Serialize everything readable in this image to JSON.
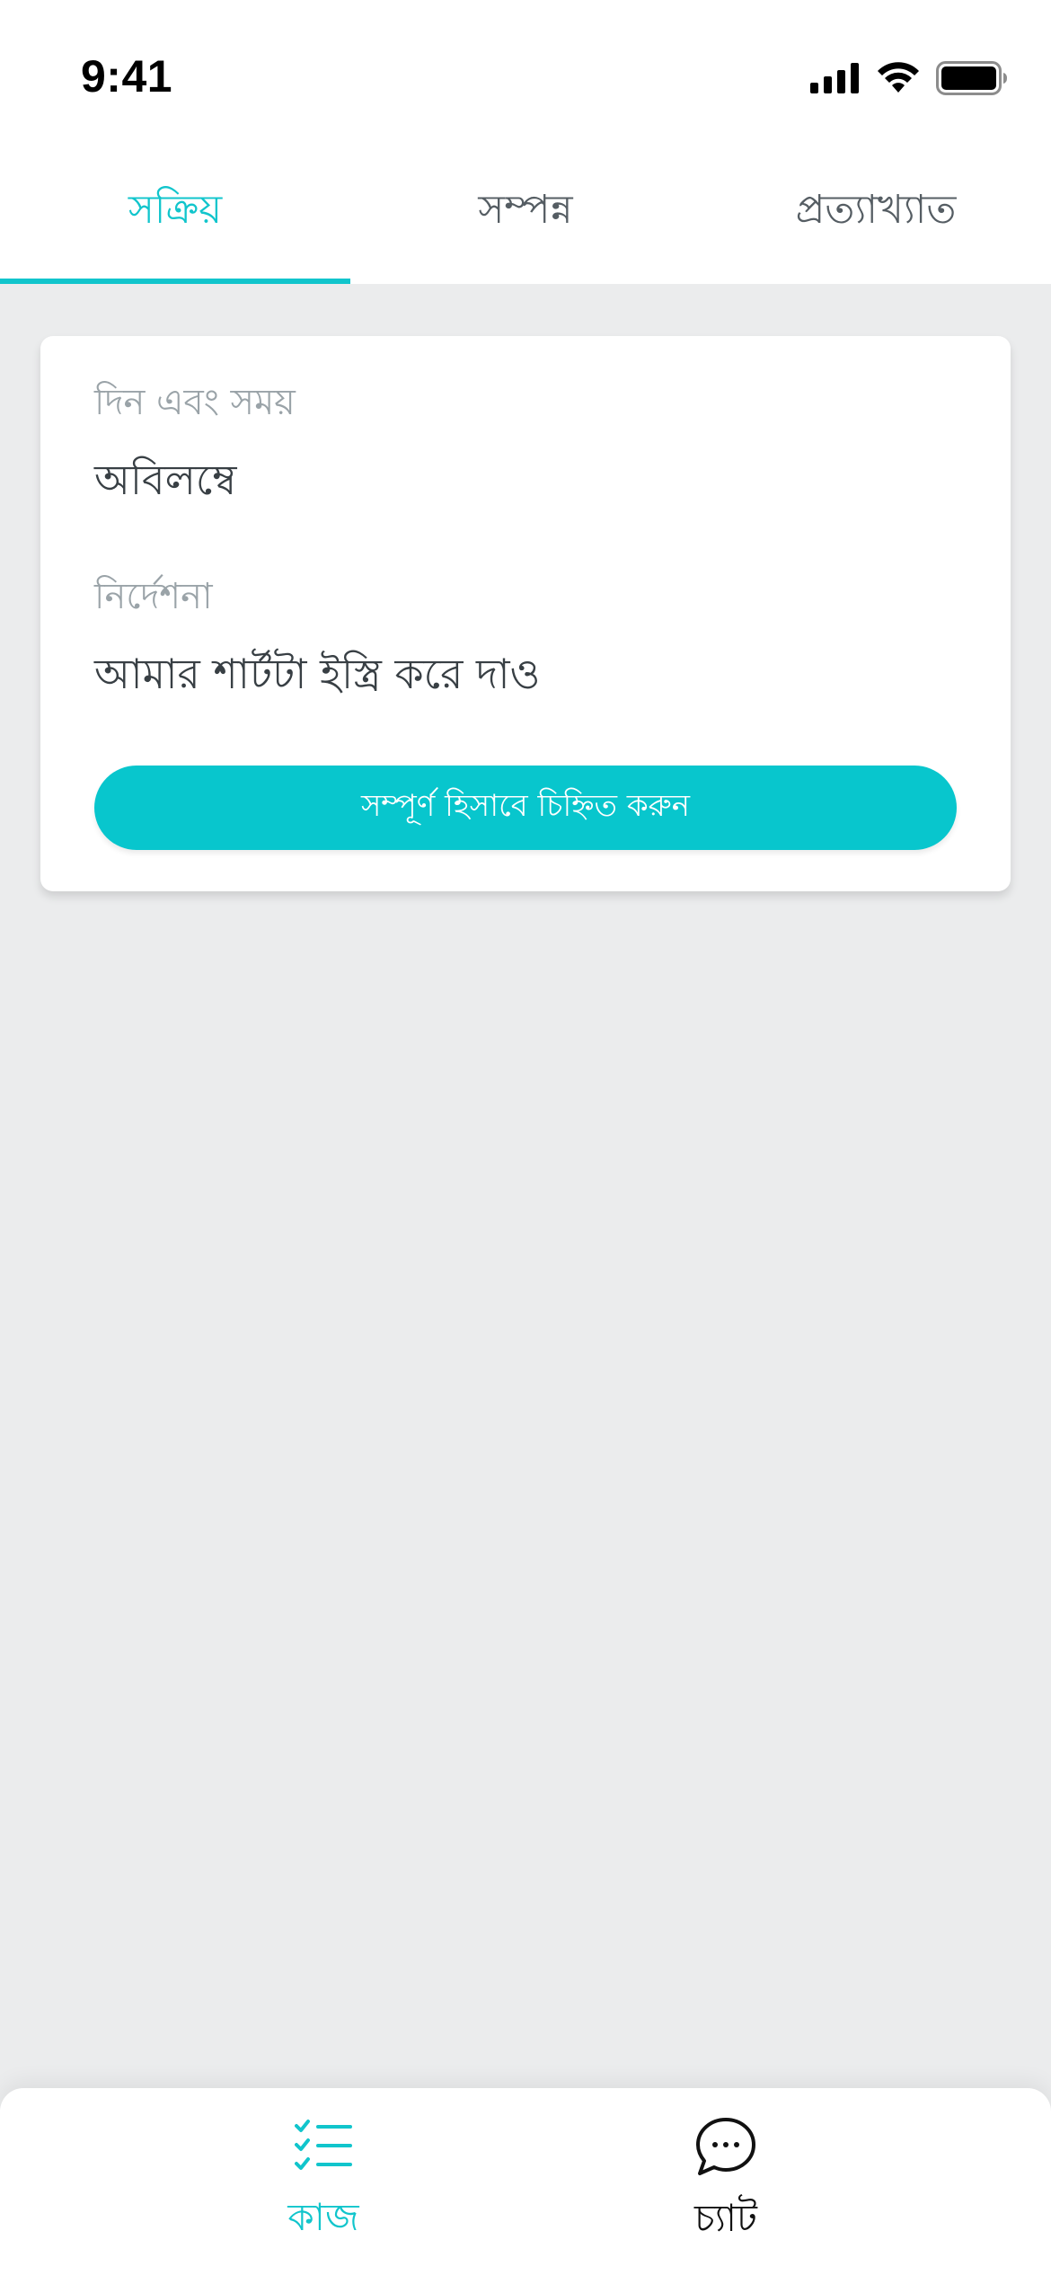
{
  "status_bar": {
    "time": "9:41"
  },
  "tabs": [
    {
      "label": "সক্রিয়",
      "active": true
    },
    {
      "label": "সম্পন্ন",
      "active": false
    },
    {
      "label": "প্রত্যাখ্যাত",
      "active": false
    }
  ],
  "task_card": {
    "datetime_label": "দিন এবং সময়",
    "datetime_value": "অবিলম্বে",
    "instruction_label": "নির্দেশনা",
    "instruction_value": "আমার শার্টটা ইস্ত্রি করে দাও",
    "complete_button": "সম্পূর্ণ হিসাবে চিহ্নিত করুন"
  },
  "bottom_nav": {
    "items": [
      {
        "label": "কাজ",
        "icon": "checklist-icon",
        "active": true
      },
      {
        "label": "চ্যাট",
        "icon": "chat-bubble-icon",
        "active": false
      }
    ]
  },
  "colors": {
    "accent": "#11c5cc",
    "background": "#ebeced",
    "text_primary": "#383f44",
    "text_muted": "#9aa3a8"
  }
}
